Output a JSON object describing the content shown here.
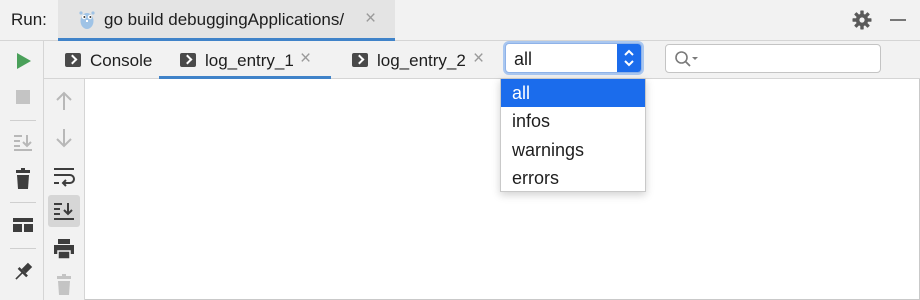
{
  "runbar": {
    "label": "Run:",
    "tab_title": "go build debuggingApplications/",
    "tab_close": "×",
    "icons": [
      "gopher-icon",
      "gear-icon",
      "minimize-icon"
    ]
  },
  "tabs": [
    {
      "label": "Console",
      "close": ""
    },
    {
      "label": "log_entry_1",
      "close": "×"
    },
    {
      "label": "log_entry_2",
      "close": "×"
    }
  ],
  "filter": {
    "value": "all",
    "options": [
      "all",
      "infos",
      "warnings",
      "errors"
    ],
    "selected_index": 0
  },
  "search": {
    "placeholder": ""
  },
  "left_toolbar": [
    "run-icon",
    "stop-icon",
    "scroll-to-end-icon",
    "delete-icon",
    "layout-icon",
    "pin-icon"
  ],
  "console_toolbar": [
    "up-arrow-icon",
    "down-arrow-icon",
    "soft-wrap-icon",
    "scroll-to-end-icon",
    "print-icon",
    "trash-icon"
  ],
  "colors": {
    "accent": "#1b6cec",
    "tab_underline": "#4083c9",
    "run_green": "#4aa05a"
  }
}
